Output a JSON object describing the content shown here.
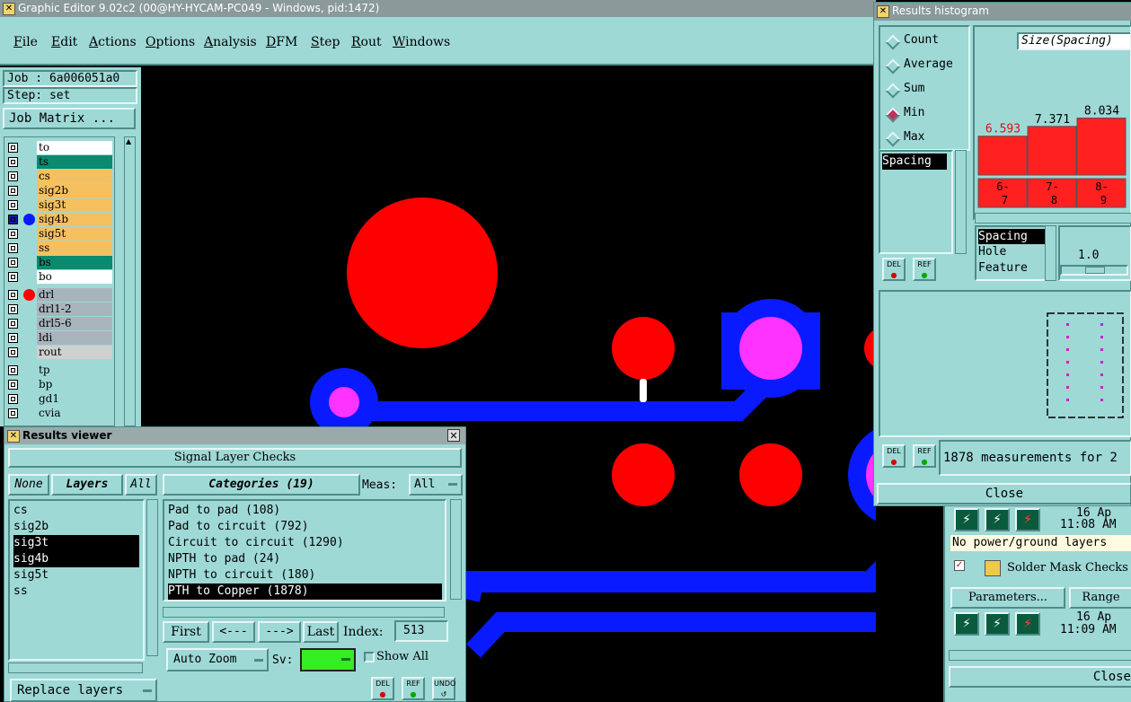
{
  "main_window": {
    "title": "Graphic Editor 9.02c2 (00@HY-HYCAM-PC049 - Windows, pid:1472)",
    "menu": [
      "File",
      "Edit",
      "Actions",
      "Options",
      "Analysis",
      "DFM",
      "Step",
      "Rout",
      "Windows"
    ],
    "job_label": "Job : 6a006051a0",
    "step_label": "Step: set",
    "job_matrix_button": "Job Matrix ..."
  },
  "layers": [
    {
      "name": "to",
      "color": "#ffffff",
      "group": 1
    },
    {
      "name": "ts",
      "color": "#0a8a6e",
      "group": 1
    },
    {
      "name": "cs",
      "color": "#f5c060",
      "group": 1
    },
    {
      "name": "sig2b",
      "color": "#f5c060",
      "group": 1
    },
    {
      "name": "sig3t",
      "color": "#f5c060",
      "group": 1
    },
    {
      "name": "sig4b",
      "color": "#f5c060",
      "group": 1
    },
    {
      "name": "sig5t",
      "color": "#f5c060",
      "group": 1
    },
    {
      "name": "ss",
      "color": "#f5c060",
      "group": 1
    },
    {
      "name": "bs",
      "color": "#0a8a6e",
      "group": 1
    },
    {
      "name": "bo",
      "color": "#ffffff",
      "group": 1
    },
    {
      "name": "drl",
      "color": "#a8b4bc",
      "group": 2
    },
    {
      "name": "drl1-2",
      "color": "#a8b4bc",
      "group": 2
    },
    {
      "name": "drl5-6",
      "color": "#a8b4bc",
      "group": 2
    },
    {
      "name": "ldi",
      "color": "#a8b4bc",
      "group": 2
    },
    {
      "name": "rout",
      "color": "#d0d0d0",
      "group": 2
    },
    {
      "name": "tp",
      "color": "#9ed9d6",
      "group": 3
    },
    {
      "name": "bp",
      "color": "#9ed9d6",
      "group": 3
    },
    {
      "name": "gd1",
      "color": "#9ed9d6",
      "group": 3
    },
    {
      "name": "cvia",
      "color": "#9ed9d6",
      "group": 3
    }
  ],
  "results_viewer": {
    "title": "Results viewer",
    "section": "Signal Layer Checks",
    "none_btn": "None",
    "layers_btn": "Layers",
    "all_btn": "All",
    "layer_list": [
      "cs",
      "sig2b",
      "sig3t",
      "sig4b",
      "sig5t",
      "ss"
    ],
    "categories_btn": "Categories (19)",
    "meas_label": "Meas:",
    "meas_value": "All",
    "categories": [
      "Pad to pad (108)",
      "Pad to circuit (792)",
      "Circuit to circuit (1290)",
      "NPTH to pad (24)",
      "NPTH to circuit (180)",
      "PTH to Copper (1878)"
    ],
    "first_btn": "First",
    "prev_btn": "<---",
    "next_btn": "--->",
    "last_btn": "Last",
    "index_label": "Index:",
    "index_value": "513",
    "auto_zoom": "Auto Zoom",
    "sv_label": "Sv:",
    "show_all": "Show All",
    "replace_layers": "Replace layers",
    "del_label": "DEL",
    "ref_label": "REF",
    "undo_label": "UNDO"
  },
  "histogram": {
    "title": "Results histogram",
    "modes": [
      "Count",
      "Average",
      "Sum",
      "Min",
      "Max"
    ],
    "selected_mode": "Min",
    "header": "Size(Spacing)",
    "list_item": "Spacing",
    "sub_list": [
      "Spacing",
      "Hole",
      "Feature"
    ],
    "slider_value": "1.0",
    "status": "1878 measurements for 2",
    "close_btn": "Close",
    "del_label": "DEL",
    "ref_label": "REF"
  },
  "chart_data": {
    "type": "bar",
    "categories": [
      "6-7",
      "7-8",
      "8-9"
    ],
    "values": [
      6.593,
      7.371,
      8.034
    ]
  },
  "drc_panel": {
    "date1": "16 Ap",
    "time1": "11:08 AM",
    "note": "No power/ground layers",
    "solder_mask": "Solder Mask Checks",
    "parameters_btn": "Parameters...",
    "range_btn": "Range",
    "date2": "16 Ap",
    "time2": "11:09 AM",
    "close_btn": "Close"
  }
}
